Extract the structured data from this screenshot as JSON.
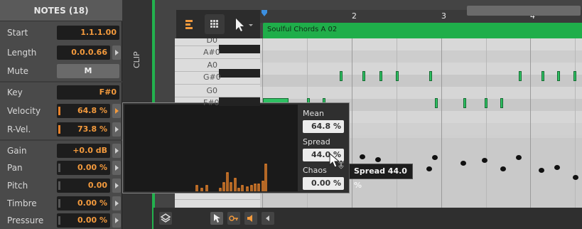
{
  "inspector": {
    "title": "NOTES (18)",
    "start": {
      "label": "Start",
      "value": "1.1.1.00"
    },
    "length": {
      "label": "Length",
      "value": "0.0.0.66"
    },
    "mute": {
      "label": "Mute",
      "value": "M"
    },
    "key": {
      "label": "Key",
      "value": "F#0"
    },
    "velocity": {
      "label": "Velocity",
      "value": "64.8 %"
    },
    "rvel": {
      "label": "R-Vel.",
      "value": "73.8 %"
    },
    "gain": {
      "label": "Gain",
      "value": "+0.0 dB"
    },
    "pan": {
      "label": "Pan",
      "value": "0.00 %"
    },
    "pitch": {
      "label": "Pitch",
      "value": "0.00"
    },
    "timbre": {
      "label": "Timbre",
      "value": "0.00 %"
    },
    "pressure": {
      "label": "Pressure",
      "value": "0.00 %"
    }
  },
  "clip_tab": "CLIP",
  "keyboard": {
    "labels": [
      "D0",
      "A#0",
      "A0",
      "G#0",
      "G0",
      "F#0"
    ]
  },
  "ruler": {
    "marks": [
      "2",
      "3",
      "4"
    ]
  },
  "clip": {
    "name": "Soulful Chords A 02"
  },
  "popup": {
    "mean_label": "Mean",
    "mean_value": "64.8 %",
    "spread_label": "Spread",
    "spread_value": "44.0 %",
    "chaos_label": "Chaos",
    "chaos_value": "0.00 %"
  },
  "tooltip": "Spread 44.0 %",
  "colors": {
    "accent": "#f39a3d",
    "clip_green": "#1fae4a",
    "inspector_bg": "#4a4a4a"
  },
  "icons": [
    "sequencer-icon",
    "grid-icon",
    "pointer-icon",
    "layers-icon",
    "select-tool-icon",
    "key-icon",
    "speaker-icon",
    "scroll-left-icon"
  ]
}
